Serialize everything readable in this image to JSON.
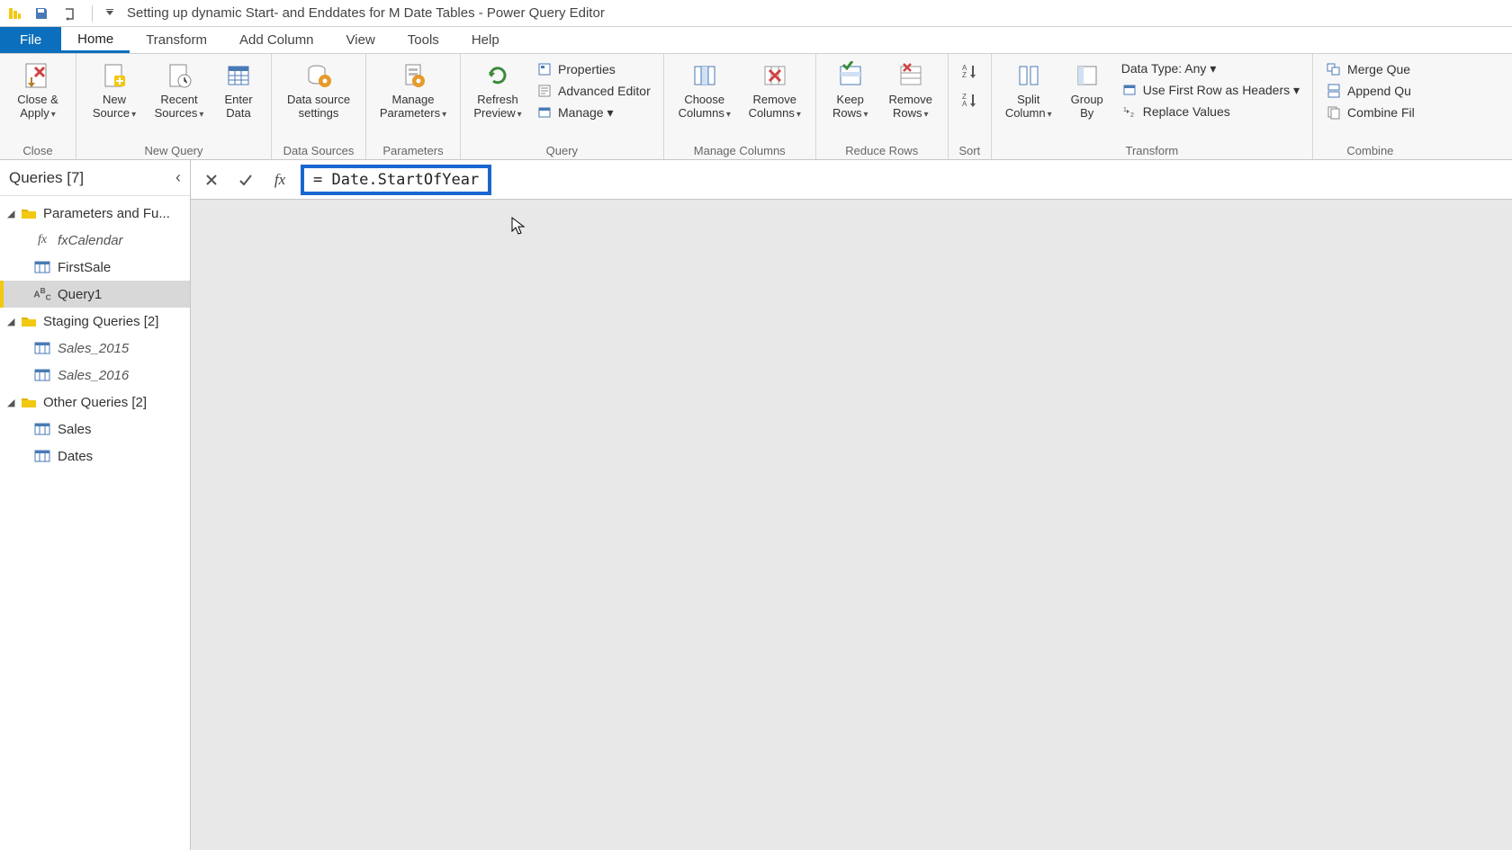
{
  "window": {
    "title": "Setting up dynamic Start- and Enddates for M Date Tables - Power Query Editor"
  },
  "tabs": {
    "file": "File",
    "home": "Home",
    "transform": "Transform",
    "add_column": "Add Column",
    "view": "View",
    "tools": "Tools",
    "help": "Help"
  },
  "ribbon": {
    "close": {
      "close_apply": "Close &\nApply",
      "group_label": "Close"
    },
    "new_query": {
      "new_source": "New\nSource",
      "recent_sources": "Recent\nSources",
      "enter_data": "Enter\nData",
      "group_label": "New Query"
    },
    "data_sources": {
      "data_source_settings": "Data source\nsettings",
      "group_label": "Data Sources"
    },
    "parameters": {
      "manage_parameters": "Manage\nParameters",
      "group_label": "Parameters"
    },
    "query": {
      "refresh_preview": "Refresh\nPreview",
      "properties": "Properties",
      "advanced_editor": "Advanced Editor",
      "manage": "Manage",
      "group_label": "Query"
    },
    "manage_columns": {
      "choose_columns": "Choose\nColumns",
      "remove_columns": "Remove\nColumns",
      "group_label": "Manage Columns"
    },
    "reduce_rows": {
      "keep_rows": "Keep\nRows",
      "remove_rows": "Remove\nRows",
      "group_label": "Reduce Rows"
    },
    "sort": {
      "group_label": "Sort"
    },
    "transform": {
      "split_column": "Split\nColumn",
      "group_by": "Group\nBy",
      "data_type": "Data Type: Any",
      "first_row_headers": "Use First Row as Headers",
      "replace_values": "Replace Values",
      "group_label": "Transform"
    },
    "combine": {
      "merge": "Merge Que",
      "append": "Append Qu",
      "combine_files": "Combine Fil",
      "group_label": "Combine"
    }
  },
  "queries_pane": {
    "title": "Queries [7]",
    "folders": [
      {
        "label": "Parameters and Fu...",
        "items": [
          {
            "label": "fxCalendar",
            "kind": "fx",
            "italic": true
          },
          {
            "label": "FirstSale",
            "kind": "table"
          },
          {
            "label": "Query1",
            "kind": "abc",
            "selected": true
          }
        ]
      },
      {
        "label": "Staging Queries [2]",
        "items": [
          {
            "label": "Sales_2015",
            "kind": "table",
            "italic": true
          },
          {
            "label": "Sales_2016",
            "kind": "table",
            "italic": true
          }
        ]
      },
      {
        "label": "Other Queries [2]",
        "items": [
          {
            "label": "Sales",
            "kind": "table"
          },
          {
            "label": "Dates",
            "kind": "table"
          }
        ]
      }
    ]
  },
  "formula_bar": {
    "text": "= Date.StartOfYear"
  }
}
